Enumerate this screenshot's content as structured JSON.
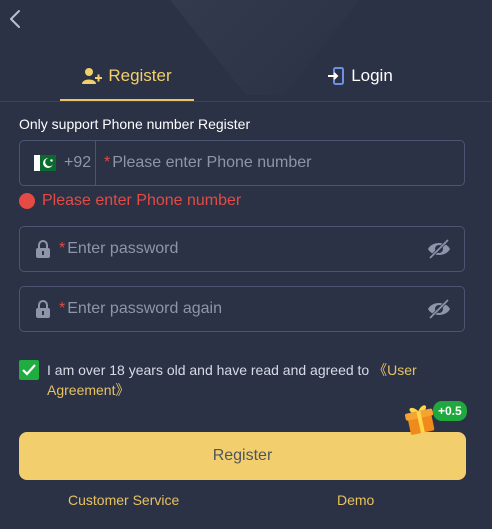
{
  "tabs": {
    "register": "Register",
    "login": "Login"
  },
  "form": {
    "section_label": "Only support Phone number Register",
    "country_code": "+92",
    "country_flag": "pakistan-flag",
    "required_mark": "*",
    "phone_placeholder": "Please enter Phone number",
    "phone_error": "Please enter Phone number",
    "password_placeholder": "Enter password",
    "password_again_placeholder": "Enter password again"
  },
  "agreement": {
    "checked": true,
    "text": "I am over 18 years old and have read and agreed to ",
    "link": "《User Agreement》"
  },
  "bonus": {
    "badge": "+0.5"
  },
  "register_button": "Register",
  "footer": {
    "customer_service": "Customer Service",
    "demo": "Demo"
  },
  "colors": {
    "background": "#2b3246",
    "accent": "#f2cf6c",
    "error": "#e54a44",
    "success": "#1fad3f"
  },
  "icons": [
    "chevron-left-icon",
    "user-add-icon",
    "login-icon",
    "lock-icon",
    "eye-off-icon",
    "check-icon",
    "gift-icon"
  ]
}
